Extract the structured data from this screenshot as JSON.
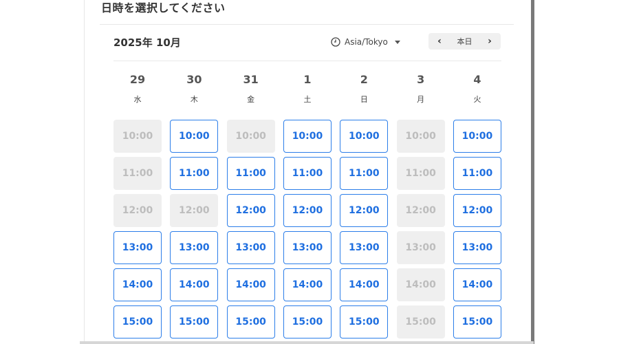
{
  "header": {
    "title": "日時を選択してください",
    "month": "2025年 10月",
    "timezone": "Asia/Tokyo",
    "nav": {
      "prev_icon": "‹",
      "today": "本日",
      "next_icon": "›"
    }
  },
  "days": [
    {
      "num": "29",
      "weekday": "水"
    },
    {
      "num": "30",
      "weekday": "木"
    },
    {
      "num": "31",
      "weekday": "金"
    },
    {
      "num": "1",
      "weekday": "土"
    },
    {
      "num": "2",
      "weekday": "日"
    },
    {
      "num": "3",
      "weekday": "月"
    },
    {
      "num": "4",
      "weekday": "火"
    }
  ],
  "times": [
    "10:00",
    "11:00",
    "12:00",
    "13:00",
    "14:00",
    "15:00"
  ],
  "availability": [
    [
      false,
      false,
      false,
      true,
      true,
      true
    ],
    [
      true,
      true,
      false,
      true,
      true,
      true
    ],
    [
      false,
      true,
      true,
      true,
      true,
      true
    ],
    [
      true,
      true,
      true,
      true,
      true,
      true
    ],
    [
      true,
      true,
      true,
      true,
      true,
      true
    ],
    [
      false,
      false,
      false,
      false,
      false,
      false
    ],
    [
      true,
      true,
      true,
      true,
      true,
      true
    ]
  ],
  "colors": {
    "available_border": "#2b7de9",
    "available_text": "#1f6fe0",
    "unavailable_bg": "#efefef",
    "unavailable_text": "#bdbdbd"
  }
}
